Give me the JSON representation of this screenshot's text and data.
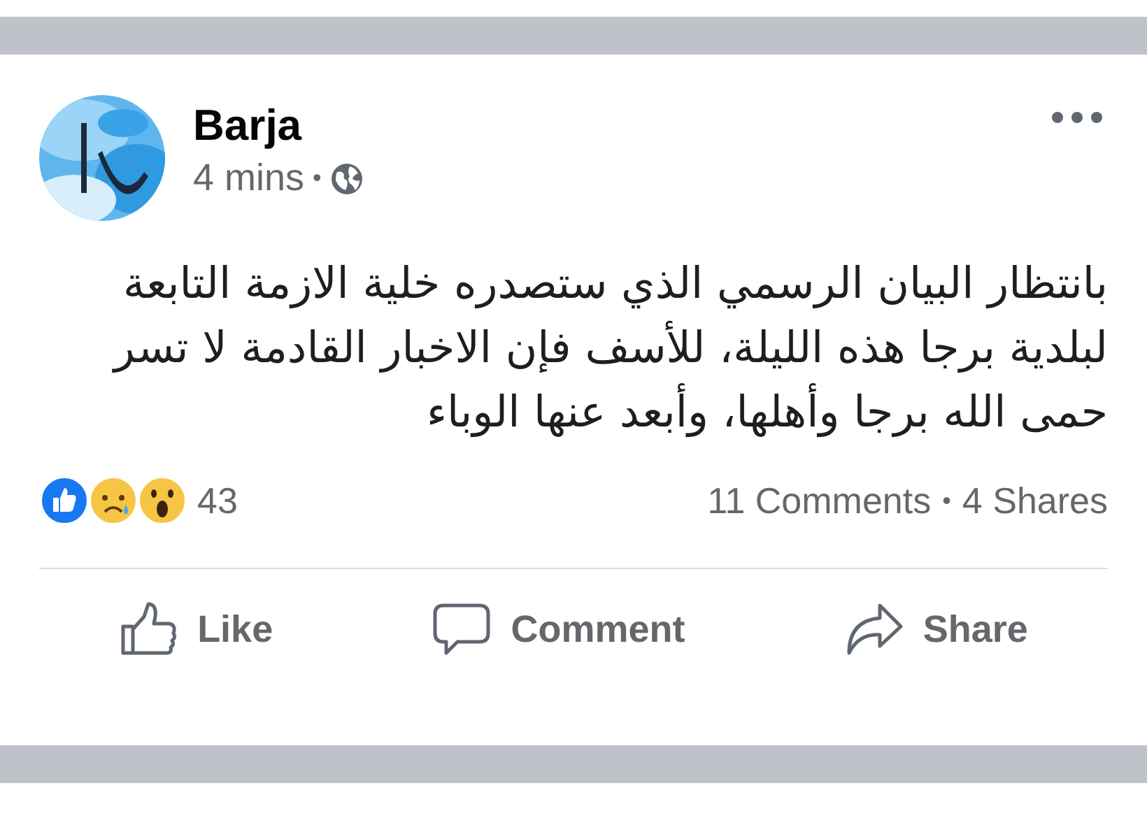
{
  "post": {
    "author": "Barja",
    "time": "4 mins",
    "separator": "•",
    "text": "بانتظار البيان الرسمي الذي ستصدره خلية الازمة التابعة\nلبلدية برجا هذه الليلة، للأسف فإن الاخبار القادمة لا تسر\nحمى الله برجا وأهلها، وأبعد عنها الوباء"
  },
  "reactions": {
    "types": [
      {
        "kind": "like"
      },
      {
        "kind": "sad"
      },
      {
        "kind": "wow"
      }
    ],
    "count": "43"
  },
  "stats": {
    "comments": "11 Comments",
    "separator": "•",
    "shares": "4 Shares"
  },
  "actions": [
    {
      "kind": "like",
      "label": "Like"
    },
    {
      "kind": "comment",
      "label": "Comment"
    },
    {
      "kind": "share",
      "label": "Share"
    }
  ]
}
